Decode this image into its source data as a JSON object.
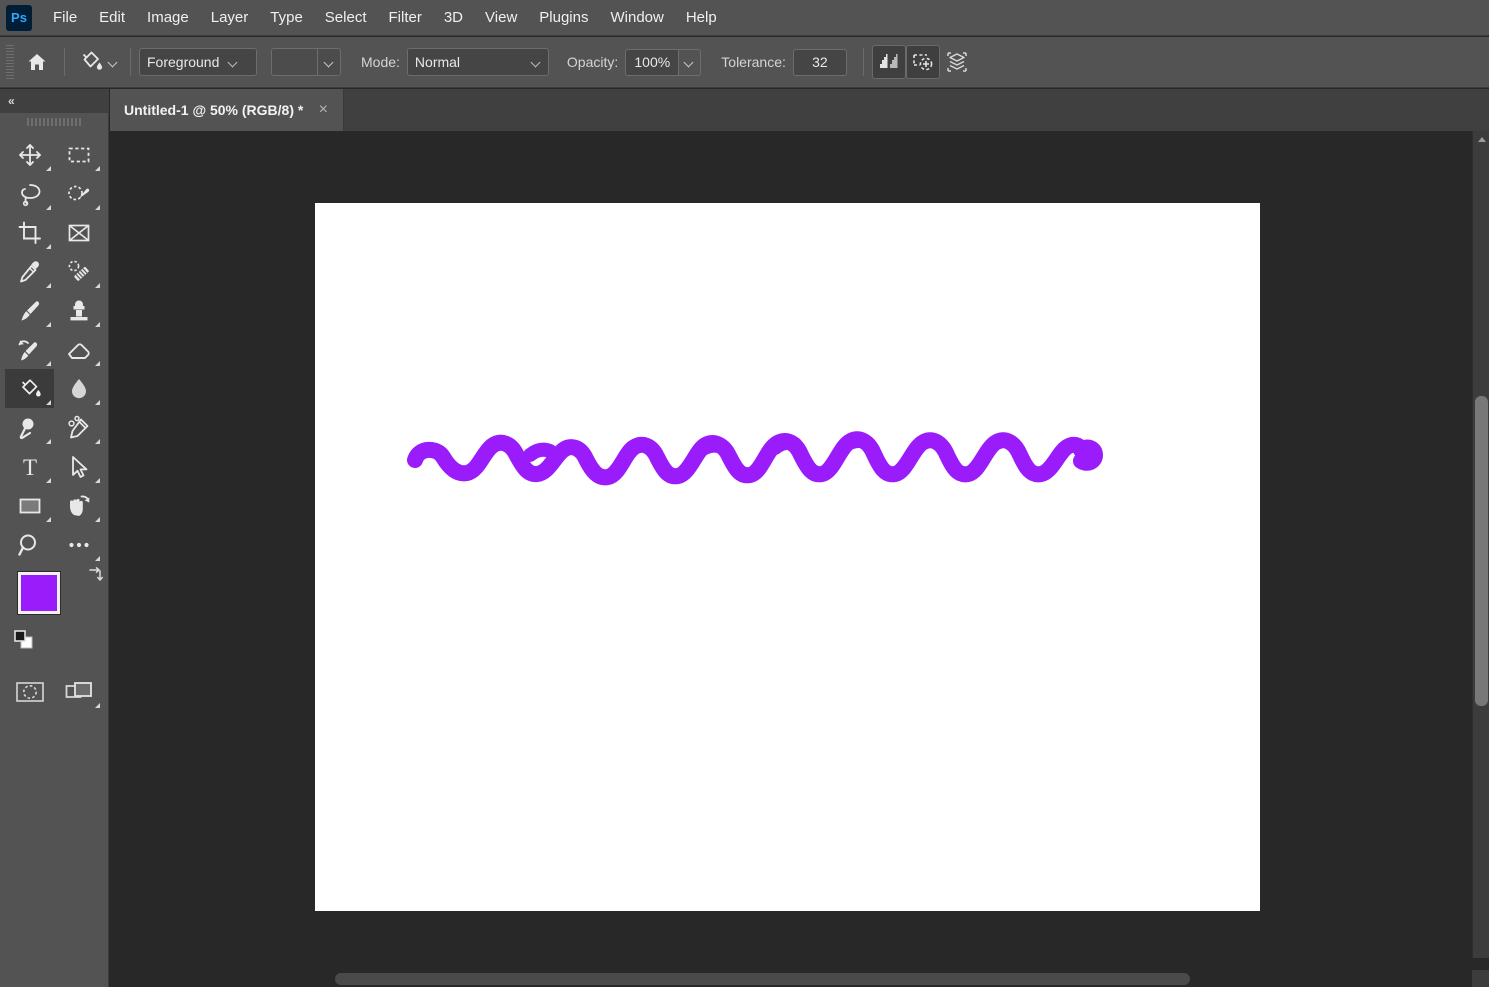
{
  "app": {
    "name": "Photoshop",
    "logo_text": "Ps",
    "accent_color": "#31a8ff",
    "chrome_color": "#535353",
    "canvas_bg_color": "#282828"
  },
  "menubar": {
    "items": [
      {
        "label": "File"
      },
      {
        "label": "Edit"
      },
      {
        "label": "Image"
      },
      {
        "label": "Layer"
      },
      {
        "label": "Type"
      },
      {
        "label": "Select"
      },
      {
        "label": "Filter"
      },
      {
        "label": "3D"
      },
      {
        "label": "View"
      },
      {
        "label": "Plugins"
      },
      {
        "label": "Window"
      },
      {
        "label": "Help"
      }
    ]
  },
  "options_bar": {
    "home_icon": "home-icon",
    "active_tool_icon": "paint-bucket-icon",
    "fill_source": {
      "value": "Foreground",
      "icon": "chevron-down-icon"
    },
    "pattern_swatch": {
      "value": "",
      "icon": "chevron-down-icon"
    },
    "mode": {
      "label": "Mode:",
      "value": "Normal",
      "icon": "chevron-down-icon"
    },
    "opacity": {
      "label": "Opacity:",
      "value": "100%",
      "icon": "chevron-down-icon"
    },
    "tolerance": {
      "label": "Tolerance:",
      "value": "32"
    },
    "toggles": [
      {
        "name": "anti-alias-icon",
        "active": true
      },
      {
        "name": "contiguous-icon",
        "active": true
      },
      {
        "name": "all-layers-icon",
        "active": false
      }
    ]
  },
  "tabs": {
    "active": 0,
    "items": [
      {
        "title": "Untitled-1 @ 50% (RGB/8) *",
        "close_icon": "close-icon"
      }
    ]
  },
  "toolbar": {
    "collapse_icon": "double-chevron-left-icon",
    "collapse_label": "«",
    "selected_tool": "paint-bucket",
    "tools": [
      {
        "name": "move-tool",
        "icon": "move-icon",
        "has_flyout": true
      },
      {
        "name": "rectangular-marquee-tool",
        "icon": "marquee-rectangle-icon",
        "has_flyout": true
      },
      {
        "name": "lasso-tool",
        "icon": "lasso-icon",
        "has_flyout": true
      },
      {
        "name": "object-selection-tool",
        "icon": "quick-selection-icon",
        "has_flyout": true
      },
      {
        "name": "crop-tool",
        "icon": "crop-icon",
        "has_flyout": true
      },
      {
        "name": "frame-tool",
        "icon": "frame-icon",
        "has_flyout": false
      },
      {
        "name": "eyedropper-tool",
        "icon": "eyedropper-icon",
        "has_flyout": true
      },
      {
        "name": "spot-healing-brush-tool",
        "icon": "healing-brush-icon",
        "has_flyout": true
      },
      {
        "name": "brush-tool",
        "icon": "brush-icon",
        "has_flyout": true
      },
      {
        "name": "clone-stamp-tool",
        "icon": "clone-stamp-icon",
        "has_flyout": true
      },
      {
        "name": "history-brush-tool",
        "icon": "history-brush-icon",
        "has_flyout": true
      },
      {
        "name": "eraser-tool",
        "icon": "eraser-icon",
        "has_flyout": true
      },
      {
        "name": "paint-bucket-tool",
        "icon": "paint-bucket-icon",
        "has_flyout": true
      },
      {
        "name": "blur-tool",
        "icon": "blur-drop-icon",
        "has_flyout": true
      },
      {
        "name": "dodge-tool",
        "icon": "dodge-icon",
        "has_flyout": true
      },
      {
        "name": "pen-tool",
        "icon": "pen-icon",
        "has_flyout": true
      },
      {
        "name": "horizontal-type-tool",
        "icon": "type-t-icon",
        "has_flyout": true
      },
      {
        "name": "path-selection-tool",
        "icon": "path-arrow-icon",
        "has_flyout": true
      },
      {
        "name": "rectangle-tool",
        "icon": "rectangle-shape-icon",
        "has_flyout": true
      },
      {
        "name": "hand-tool",
        "icon": "hand-rotate-icon",
        "has_flyout": true
      },
      {
        "name": "zoom-tool",
        "icon": "magnifier-icon",
        "has_flyout": false
      },
      {
        "name": "edit-toolbar",
        "icon": "ellipsis-icon",
        "has_flyout": true
      }
    ],
    "colors": {
      "foreground": "#9b1cfa",
      "background": "#ffffff",
      "swap_icon": "swap-colors-icon",
      "default_icon": "default-colors-icon"
    },
    "bottom_tools": [
      {
        "name": "quick-mask-mode",
        "icon": "quick-mask-icon",
        "has_flyout": false
      },
      {
        "name": "screen-mode",
        "icon": "screen-mode-icon",
        "has_flyout": true
      }
    ]
  },
  "document": {
    "background": "#ffffff",
    "artwork": {
      "name": "purple-squiggle-wave",
      "stroke_color": "#9b1cfa",
      "stroke_width": 16
    }
  },
  "scrollbars": {
    "vertical": {
      "up_arrow_icon": "chevron-up-icon"
    },
    "horizontal": {
      "name": "horizontal-scrollbar"
    }
  }
}
